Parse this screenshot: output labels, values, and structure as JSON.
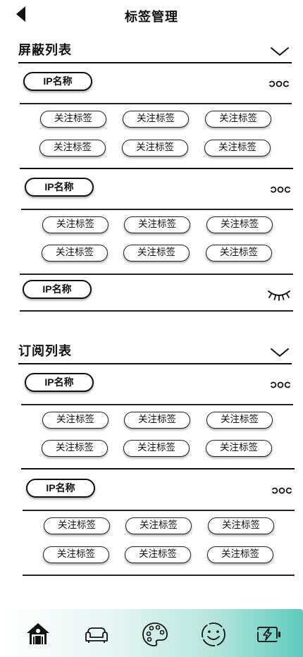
{
  "header": {
    "title": "标签管理",
    "back_icon": "back-arrow-icon"
  },
  "blocked_section": {
    "title": "屏蔽列表",
    "collapse_icon": "chevron-down-icon",
    "groups": [
      {
        "ip_label": "IP名称",
        "action_icon": "more-icon",
        "tags": [
          "关注标签",
          "关注标签",
          "关注标签",
          "关注标签",
          "关注标签",
          "关注标签"
        ]
      },
      {
        "ip_label": "IP名称",
        "action_icon": "more-icon",
        "tags": [
          "关注标签",
          "关注标签",
          "关注标签",
          "关注标签",
          "关注标签",
          "关注标签"
        ]
      },
      {
        "ip_label": "IP名称",
        "action_icon": "eye-closed-icon",
        "tags": []
      }
    ]
  },
  "subscribed_section": {
    "title": "订阅列表",
    "collapse_icon": "chevron-down-icon",
    "groups": [
      {
        "ip_label": "IP名称",
        "action_icon": "more-icon",
        "tags": [
          "关注标签",
          "关注标签",
          "关注标签",
          "关注标签",
          "关注标签",
          "关注标签"
        ]
      },
      {
        "ip_label": "IP名称",
        "action_icon": "more-icon",
        "tags": [
          "关注标签",
          "关注标签",
          "关注标签",
          "关注标签",
          "关注标签",
          "关注标签"
        ]
      }
    ]
  },
  "bottom_nav": {
    "items": [
      "home-icon",
      "sofa-icon",
      "palette-icon",
      "smile-icon",
      "battery-charge-icon"
    ],
    "active": "home-icon",
    "gradient_colors": [
      "#ffffff",
      "#5fcabd"
    ]
  }
}
